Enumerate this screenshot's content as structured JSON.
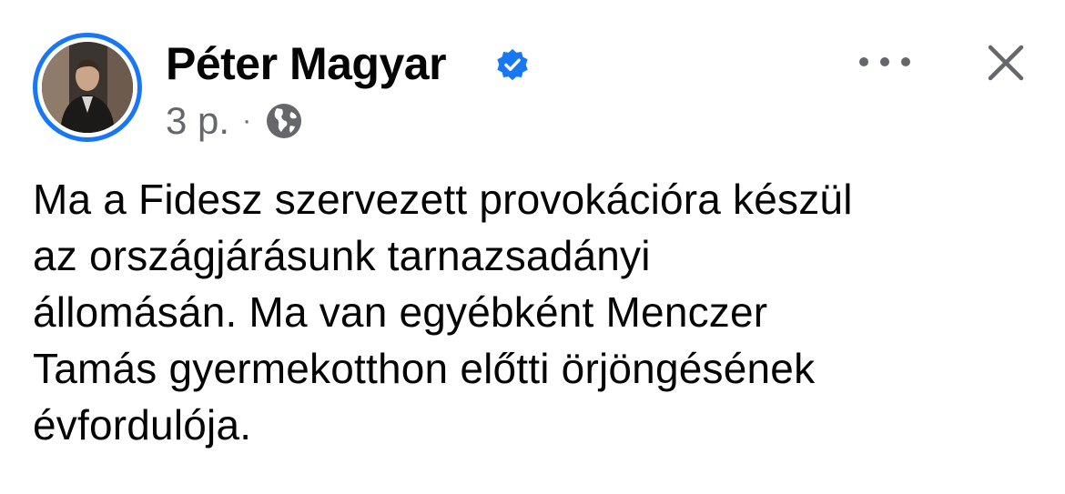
{
  "post": {
    "author": "Péter Magyar",
    "verified": true,
    "timestamp": "3 p.",
    "separator": "·",
    "audience_icon": "globe-icon",
    "body_lines": [
      "Ma a Fidesz szervezett provokációra készül",
      "az országjárásunk tarnazsadányi",
      "állomásán. Ma van egyébként Menczer",
      "Tamás gyermekotthon előtti örjöngésének",
      "évfordulója."
    ]
  },
  "actions": {
    "more_icon": "more-horizontal-icon",
    "close_icon": "close-icon"
  },
  "colors": {
    "accent": "#1877f2",
    "text_primary": "#050505",
    "text_secondary": "#65676b"
  }
}
